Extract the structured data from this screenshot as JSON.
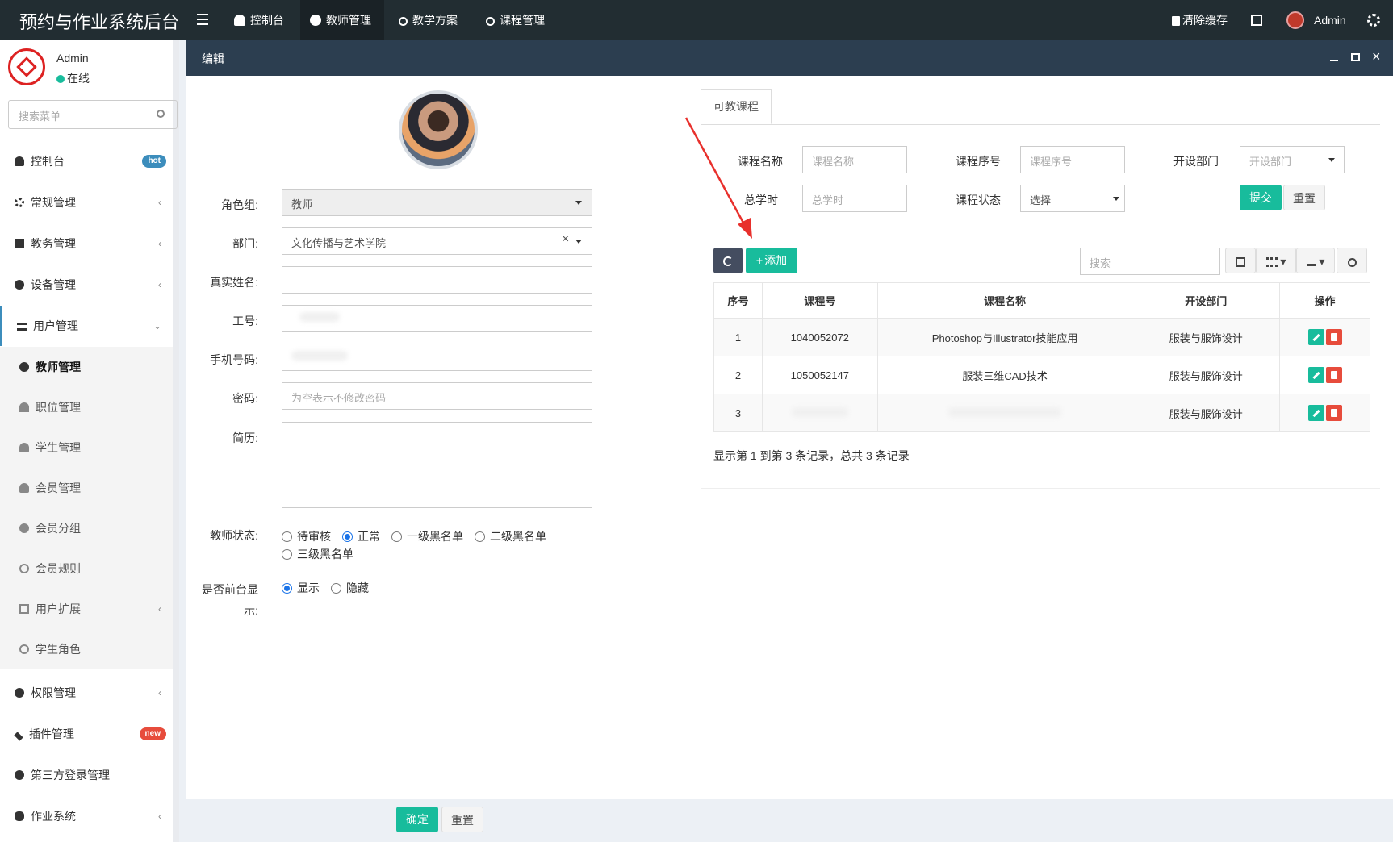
{
  "app": {
    "title": "预约与作业系统后台"
  },
  "topnav": {
    "items": [
      {
        "label": "控制台"
      },
      {
        "label": "教师管理"
      },
      {
        "label": "教学方案"
      },
      {
        "label": "课程管理"
      }
    ],
    "clear_cache": "清除缓存",
    "user": "Admin"
  },
  "sidebar": {
    "user": {
      "name": "Admin",
      "status": "在线"
    },
    "search_placeholder": "搜索菜单",
    "items": [
      {
        "label": "控制台",
        "badge": "hot"
      },
      {
        "label": "常规管理"
      },
      {
        "label": "教务管理"
      },
      {
        "label": "设备管理"
      },
      {
        "label": "用户管理"
      },
      {
        "label": "权限管理"
      },
      {
        "label": "插件管理",
        "badge": "new"
      },
      {
        "label": "第三方登录管理"
      },
      {
        "label": "作业系统"
      }
    ],
    "subitems": [
      {
        "label": "教师管理"
      },
      {
        "label": "职位管理"
      },
      {
        "label": "学生管理"
      },
      {
        "label": "会员管理"
      },
      {
        "label": "会员分组"
      },
      {
        "label": "会员规则"
      },
      {
        "label": "用户扩展"
      },
      {
        "label": "学生角色"
      }
    ]
  },
  "modal": {
    "title": "编辑",
    "form": {
      "role_label": "角色组:",
      "role_value": "教师",
      "dept_label": "部门:",
      "dept_value": "文化传播与艺术学院",
      "name_label": "真实姓名:",
      "job_label": "工号:",
      "phone_label": "手机号码:",
      "password_label": "密码:",
      "password_placeholder": "为空表示不修改密码",
      "resume_label": "简历:",
      "status_label": "教师状态:",
      "status_options": [
        "待审核",
        "正常",
        "一级黑名单",
        "二级黑名单",
        "三级黑名单"
      ],
      "status_selected": 1,
      "display_label": "是否前台显示:",
      "display_options": [
        "显示",
        "隐藏"
      ],
      "display_selected": 0
    },
    "courses": {
      "tab": "可教课程",
      "filters": {
        "name_label": "课程名称",
        "name_placeholder": "课程名称",
        "no_label": "课程序号",
        "no_placeholder": "课程序号",
        "dept_label": "开设部门",
        "dept_placeholder": "开设部门",
        "hours_label": "总学时",
        "hours_placeholder": "总学时",
        "status_label": "课程状态",
        "status_value": "选择",
        "submit": "提交",
        "reset": "重置"
      },
      "toolbar": {
        "add": "添加",
        "search_placeholder": "搜索"
      },
      "columns": [
        "序号",
        "课程号",
        "课程名称",
        "开设部门",
        "操作"
      ],
      "rows": [
        {
          "idx": "1",
          "code": "1040052072",
          "name": "Photoshop与Illustrator技能应用",
          "dept": "服装与服饰设计"
        },
        {
          "idx": "2",
          "code": "1050052147",
          "name": "服装三维CAD技术",
          "dept": "服装与服饰设计"
        },
        {
          "idx": "3",
          "code": "",
          "name": "",
          "dept": "服装与服饰设计"
        }
      ],
      "summary": "显示第 1 到第 3 条记录，总共 3 条记录"
    },
    "footer": {
      "confirm": "确定",
      "reset": "重置"
    }
  },
  "colors": {
    "topbar": "#222d32",
    "modal_header": "#2c3e50",
    "accent": "#18bc9c",
    "danger": "#e74c3c",
    "arrow": "#e8302c"
  }
}
